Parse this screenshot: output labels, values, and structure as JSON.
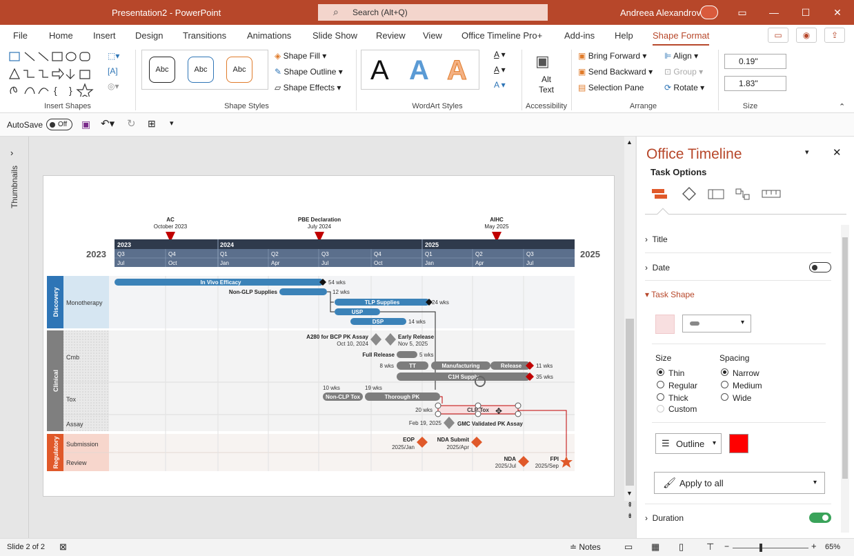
{
  "titlebar": {
    "title": "Presentation2  -  PowerPoint",
    "search": "Search (Alt+Q)",
    "user": "Andreea Alexandrov"
  },
  "tabs": [
    "File",
    "Home",
    "Insert",
    "Design",
    "Transitions",
    "Animations",
    "Slide Show",
    "Review",
    "View",
    "Office Timeline Pro+",
    "Add-ins",
    "Help",
    "Shape Format"
  ],
  "ribbon": {
    "groups": [
      "Insert Shapes",
      "Shape Styles",
      "WordArt Styles",
      "Accessibility",
      "Arrange",
      "Size"
    ],
    "styles": [
      "Abc",
      "Abc",
      "Abc"
    ],
    "shape_fill": "Shape Fill",
    "shape_outline": "Shape Outline",
    "shape_effects": "Shape Effects",
    "alt_text": "Alt Text",
    "bring_forward": "Bring Forward",
    "send_backward": "Send Backward",
    "selection_pane": "Selection Pane",
    "align": "Align",
    "group": "Group",
    "rotate": "Rotate",
    "height": "0.19\"",
    "width": "1.83\""
  },
  "qat": {
    "autosave": "AutoSave",
    "toggle": "Off"
  },
  "thumbnails": "Thumbnails",
  "timeline": {
    "milestones_top": [
      {
        "label": "AC",
        "date": "October 2023"
      },
      {
        "label": "PBE Declaration",
        "date": "July 2024"
      },
      {
        "label": "AIHC",
        "date": "May 2025"
      }
    ],
    "years": [
      "2023",
      "2024",
      "2025"
    ],
    "year_left": "2023",
    "year_right": "2025",
    "quarters": [
      "Q3",
      "Q4",
      "Q1",
      "Q2",
      "Q3",
      "Q4",
      "Q1",
      "Q2",
      "Q3"
    ],
    "months": [
      "Jul",
      "Oct",
      "Jan",
      "Apr",
      "Jul",
      "Oct",
      "Jan",
      "Apr",
      "Jul"
    ],
    "groups": [
      "Discovery",
      "Clinical",
      "Regulatory"
    ],
    "swimlanes": [
      "Monotherapy",
      "Cmb",
      "Tox",
      "Assay",
      "Submission",
      "Review"
    ],
    "tasks": {
      "in_vivo": "In Vivo Efficacy",
      "in_vivo_dur": "54 wks",
      "non_glp_label": "Non-GLP Supplies",
      "non_glp_dur": "12 wks",
      "tlp": "TLP Supplies",
      "tlp_dur": "24 wks",
      "usp": "USP",
      "dsp": "DSP",
      "dsp_dur": "14 wks",
      "a280_label": "A280 for BCP PK Assay",
      "a280_date": "Oct 10, 2024",
      "early_label": "Early Release",
      "early_date": "Nov 5, 2025",
      "full_label": "Full Release",
      "full_dur": "5 wks",
      "tt": "TT",
      "tt_dur": "8 wks",
      "mfg": "Manufacturing",
      "release": "Release",
      "release_dur": "11 wks",
      "c1h": "C1H Supply",
      "c1h_dur": "35 wks",
      "nonclp": "Non-CLP Tox",
      "nonclp_dur": "10 wks",
      "thorough": "Thorough PK",
      "thorough_dur": "19 wks",
      "clp": "CLP Tox",
      "clp_dur": "20 wks",
      "gmc_date": "Feb 19, 2025",
      "gmc_label": "GMC Validated PK Assay",
      "eop_label": "EOP",
      "eop_date": "2025/Jan",
      "nda_sub_label": "NDA Submit",
      "nda_sub_date": "2025/Apr",
      "nda_label": "NDA",
      "nda_date": "2025/Jul",
      "fpi_label": "FPI",
      "fpi_date": "2025/Sep"
    }
  },
  "panel": {
    "title": "Office Timeline",
    "subtitle": "Task Options",
    "sections": {
      "title": "Title",
      "date": "Date",
      "task_shape": "Task Shape",
      "duration": "Duration"
    },
    "size_label": "Size",
    "spacing_label": "Spacing",
    "size_options": [
      "Thin",
      "Regular",
      "Thick",
      "Custom"
    ],
    "spacing_options": [
      "Narrow",
      "Medium",
      "Wide"
    ],
    "outline": "Outline",
    "apply": "Apply to all",
    "outline_color": "#ff0000"
  },
  "status": {
    "slide": "Slide 2 of 2",
    "notes": "Notes",
    "zoom": "65%"
  },
  "colors": {
    "brand": "#b7472a",
    "blue_bar": "#3b82b8",
    "gray_bar": "#7d7d7d",
    "discovery": "#2e75b6",
    "clinical": "#7f7f7f",
    "regulatory": "#e0592a"
  }
}
